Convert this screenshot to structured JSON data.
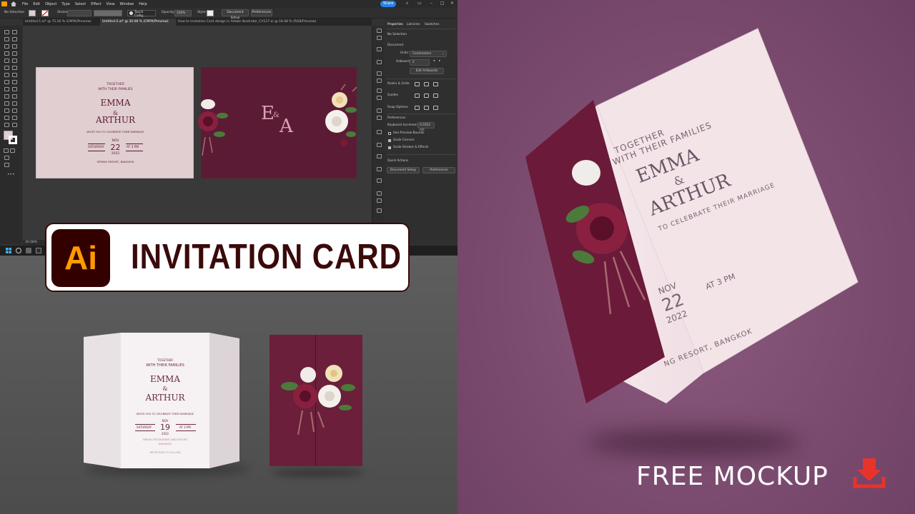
{
  "menubar": {
    "items": [
      "File",
      "Edit",
      "Object",
      "Type",
      "Select",
      "Effect",
      "View",
      "Window",
      "Help"
    ],
    "share_label": "Share"
  },
  "controlbar": {
    "no_selection": "No Selection",
    "stroke_label": "Stroke:",
    "brush": "Touch Callig...",
    "opacity_label": "Opacity:",
    "opacity_value": "100%",
    "style_label": "Style:",
    "document_setup": "Document Setup",
    "preferences": "Preferences"
  },
  "doc_tabs": [
    "Untitled-1.ai* @ 75.26 % (CMYK/Preview)",
    "Untitled-2.ai* @ 30.08 % (CMYK/Preview)",
    "How to Invitation Card design in Adobe Illustrator_CV117.ai @ 18.48 % (RGB/Preview)"
  ],
  "status_zoom": "30.08%",
  "properties": {
    "tabs": [
      "Properties",
      "Libraries",
      "Swatches"
    ],
    "no_selection": "No Selection",
    "document": "Document",
    "units_label": "Units:",
    "units_value": "Centimeters",
    "artboard_label": "Artboard:",
    "artboard_value": "2",
    "edit_artboards": "Edit Artboards",
    "rulers_grids": "Rulers & Grids",
    "guides": "Guides",
    "snap_options": "Snap Options",
    "preferences": "Preferences",
    "keyboard_increment_label": "Keyboard Increment:",
    "keyboard_increment_value": "0.0353 cm",
    "use_preview_bounds": "Use Preview Bounds",
    "scale_corners": "Scale Corners",
    "scale_strokes": "Scale Strokes & Effects",
    "quick_actions": "Quick Actions",
    "document_setup": "Document Setup",
    "preferences_btn": "Preferences"
  },
  "artboard_card": {
    "together": "TOGETHER",
    "families": "WITH THEIR FAMILIES",
    "name1": "EMMA",
    "amp": "&",
    "name2": "ARTHUR",
    "invite": "INVITE YOU TO CELEBRATE THEIR MARRIAGE",
    "month": "NOV",
    "day_label": "SATURDAY",
    "day": "22",
    "time": "AT 3 PM",
    "year": "2022",
    "venue": "SPRING RESORT, BANGKOK"
  },
  "artboard_cover": {
    "mono_e": "E",
    "mono_amp": "&",
    "mono_a": "A"
  },
  "banner": {
    "logo_text": "Ai",
    "title": "INVITATION CARD"
  },
  "mockup_left_card": {
    "together": "TOGETHER",
    "families": "WITH THEIR FAMILIES",
    "name1": "EMMA",
    "amp": "&",
    "name2": "ARTHUR",
    "invite": "INVITE YOU TO CELEBRATE THEIR MARRIAGE",
    "month": "NOV",
    "day_label": "SATURDAY",
    "day": "19",
    "time": "AT 3 PM",
    "year": "2022",
    "venue1": "SPRING RESTAURANT AND RESORT",
    "venue2": "BANGKOK",
    "reception": "RECEPTION TO FOLLOW"
  },
  "mockup_right_card": {
    "together": "TOGETHER",
    "families": "WITH THEIR FAMILIES",
    "name1": "EMMA",
    "amp": "&",
    "name2": "ARTHUR",
    "invite": "TO CELEBRATE THEIR MARRIAGE",
    "month": "NOV",
    "day": "22",
    "time": "AT 3 PM",
    "year": "2022",
    "venue": "NG RESORT, BANGKOK"
  },
  "footer": {
    "free_mockup": "FREE MOCKUP"
  },
  "colors": {
    "burgundy": "#5c1b35",
    "card_pink": "#e0ced0",
    "purple_bg": "#7a4a6e",
    "download_red": "#e8332a",
    "ai_orange": "#ff9a00",
    "ai_bg": "#330000"
  }
}
